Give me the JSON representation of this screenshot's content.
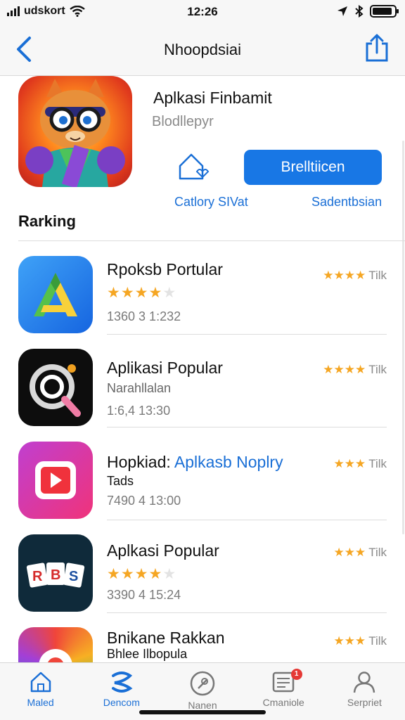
{
  "status_bar": {
    "carrier": "udskort",
    "time": "12:26",
    "battery_level": 0.9
  },
  "nav": {
    "title": "Nhoopdsiai"
  },
  "featured": {
    "title": "Aplkasi Finbamit",
    "subtitle": "Blodllepyr",
    "get_label": "Brelltiicen",
    "category_label": "Catlory SIVat",
    "sub_label": "Sadentbsian"
  },
  "section": {
    "title": "Rarking"
  },
  "apps": [
    {
      "name": "Rpoksb Portular",
      "sub": "",
      "stars_shown": true,
      "rating": 4.5,
      "meta": "1360 3  1:232",
      "right_stars": 4,
      "right_text": "Tilk"
    },
    {
      "name": "Aplikasi Popular",
      "sub": "Narahllalan",
      "stars_shown": false,
      "rating": 0,
      "meta": "1:6,4  13:30",
      "right_stars": 4,
      "right_text": "Tilk"
    },
    {
      "name_part1": "Hopkiad:",
      "name_part2": "Aplkasb Noplry",
      "sub": "Tads",
      "stars_shown": false,
      "rating": 0,
      "meta": "7490 4  13:00",
      "right_stars": 3,
      "right_text": "Tilk"
    },
    {
      "name": "Aplkasi Popular",
      "sub": "",
      "stars_shown": true,
      "rating": 4.5,
      "meta": "3390 4  15:24",
      "right_stars": 3,
      "right_text": "Tilk"
    },
    {
      "name": "Bnikane Rakkan",
      "sub": "Bhlee Ilbopula",
      "stars_shown": false,
      "rating": 0,
      "meta": "",
      "right_stars": 3,
      "right_text": "Tilk"
    }
  ],
  "tabs": [
    {
      "label": "Maled",
      "icon": "home-icon",
      "active": true
    },
    {
      "label": "Dencom",
      "icon": "discover-icon",
      "active": true
    },
    {
      "label": "Nanen",
      "icon": "search-icon",
      "active": false
    },
    {
      "label": "Cmaniole",
      "icon": "updates-icon",
      "active": false,
      "badge": "1"
    },
    {
      "label": "Serpriet",
      "icon": "account-icon",
      "active": false
    }
  ],
  "colors": {
    "accent": "#1877e5",
    "star": "#f5a623",
    "badge": "#e53935"
  }
}
